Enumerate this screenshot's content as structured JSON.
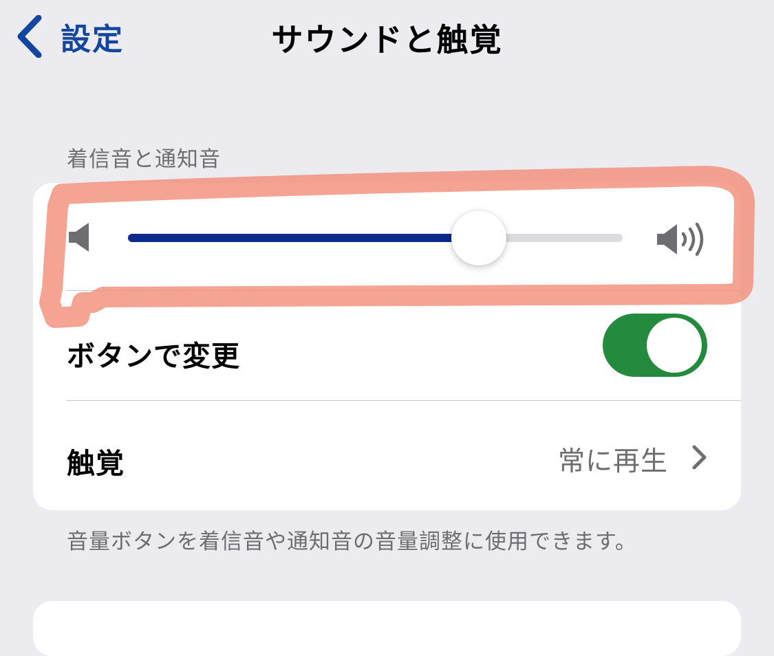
{
  "nav": {
    "back_label": "設定",
    "title": "サウンドと触覚"
  },
  "ringtone_section": {
    "header": "着信音と通知音",
    "slider": {
      "value_fraction": 0.71,
      "low_icon": "speaker-low-icon",
      "high_icon": "speaker-high-icon",
      "fill_color": "#0b2a8e"
    },
    "change_with_buttons": {
      "label": "ボタンで変更",
      "on": true,
      "color": "#238a3e"
    },
    "haptics": {
      "label": "触覚",
      "value": "常に再生"
    },
    "footer": "音量ボタンを着信音や通知音の音量調整に使用できます。"
  },
  "annotation": {
    "color": "#f28c78"
  }
}
